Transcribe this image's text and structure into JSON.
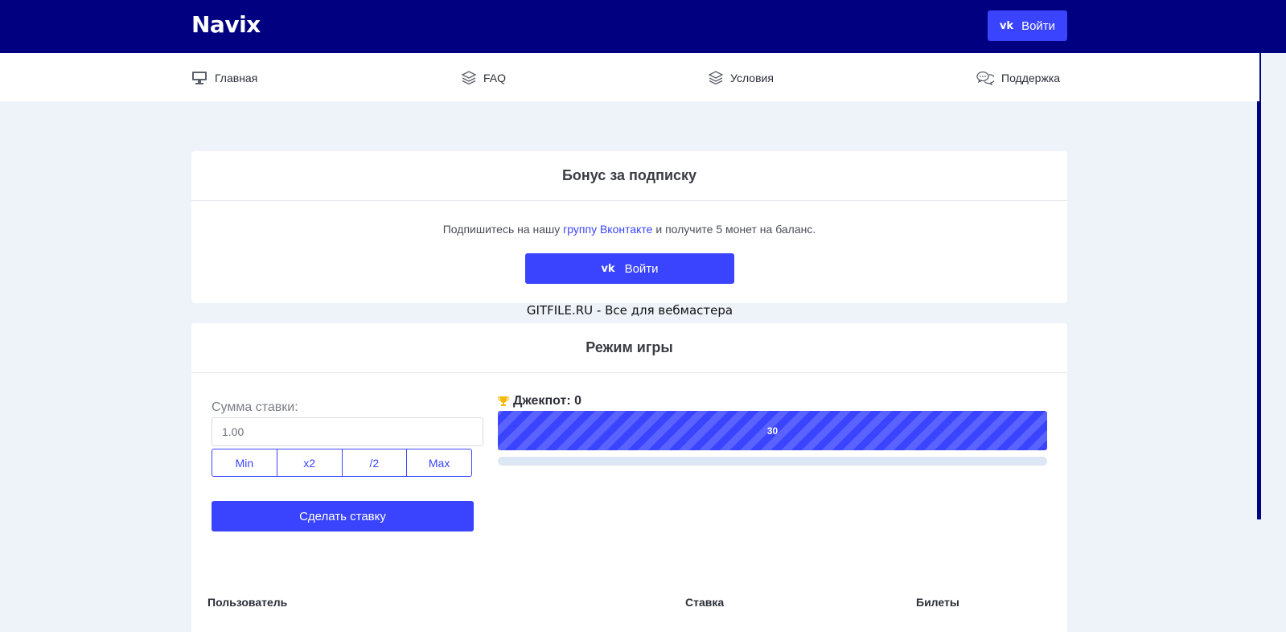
{
  "header": {
    "logo": "Navix",
    "login_label": "Войти",
    "vk_icon_text": "vk"
  },
  "nav": {
    "items": [
      {
        "label": "Главная",
        "icon": "monitor-icon"
      },
      {
        "label": "FAQ",
        "icon": "layers-icon"
      },
      {
        "label": "Условия",
        "icon": "layers-icon"
      },
      {
        "label": "Поддержка",
        "icon": "chat-icon"
      }
    ]
  },
  "bonus": {
    "title": "Бонус за подписку",
    "text_before": "Подпишитесь на нашу",
    "link_text": "группу Вконтакте",
    "text_after": "и получите 5 монет на баланс.",
    "login_label": "Войти"
  },
  "watermark": "GITFILE.RU - Все для вебмастера",
  "game": {
    "title": "Режим игры",
    "bet_label": "Сумма ставки:",
    "bet_value": "1.00",
    "buttons": [
      "Min",
      "x2",
      "/2",
      "Max"
    ],
    "place_bet_label": "Сделать ставку",
    "jackpot_label": "Джекпот: 0",
    "timer_value": "30",
    "table_headers": [
      "Пользователь",
      "Ставка",
      "Билеты"
    ]
  },
  "colors": {
    "header_bg": "#000080",
    "accent": "#3a44ff",
    "page_bg": "#eef3fa"
  }
}
